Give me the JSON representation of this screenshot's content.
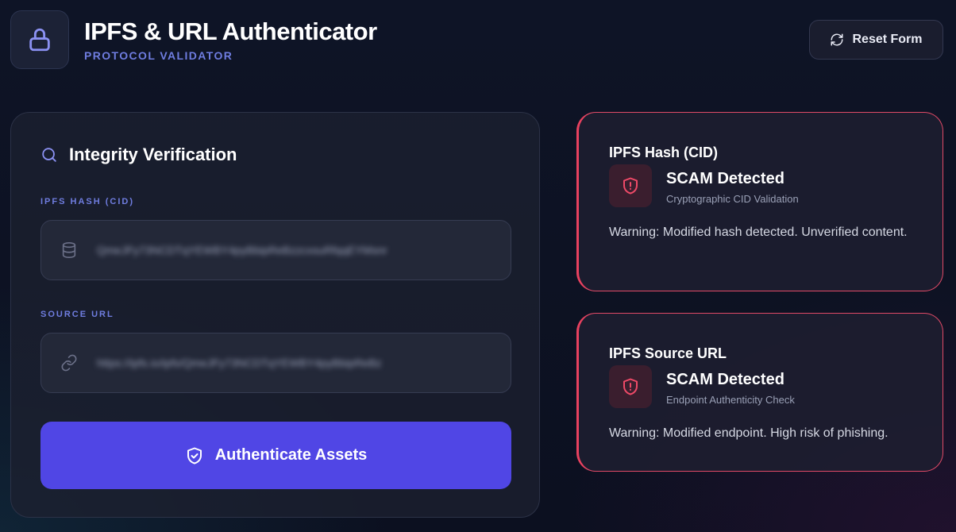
{
  "header": {
    "title": "IPFS & URL Authenticator",
    "subtitle": "PROTOCOL VALIDATOR",
    "logo_icon": "lock-icon",
    "reset_label": "Reset Form",
    "reset_icon": "refresh-icon"
  },
  "form": {
    "title": "Integrity Verification",
    "title_icon": "search-icon",
    "hash_label": "IPFS HASH (CID)",
    "hash_value": "QmeJFy73NCDTqYEWBY4pyBbipReBzzcxsuRfqqEYMsnr",
    "hash_icon": "database-icon",
    "url_label": "SOURCE URL",
    "url_value": "https://ipfs.io/ipfs/QmeJFy73NCDTqYEWBY4pyBbipReBz",
    "url_icon": "link-icon",
    "submit_label": "Authenticate Assets",
    "submit_icon": "shield-check-icon"
  },
  "results": [
    {
      "heading": "IPFS Hash (CID)",
      "status": "SCAM Detected",
      "check": "Cryptographic CID Validation",
      "message": "Warning: Modified hash detected. Unverified content.",
      "icon": "shield-alert-icon"
    },
    {
      "heading": "IPFS Source URL",
      "status": "SCAM Detected",
      "check": "Endpoint Authenticity Check",
      "message": "Warning: Modified endpoint. High risk of phishing.",
      "icon": "shield-alert-icon"
    }
  ],
  "colors": {
    "accent": "#5046e5",
    "label": "#6f7de0",
    "danger": "#e8415f",
    "background": "#0e1426"
  }
}
